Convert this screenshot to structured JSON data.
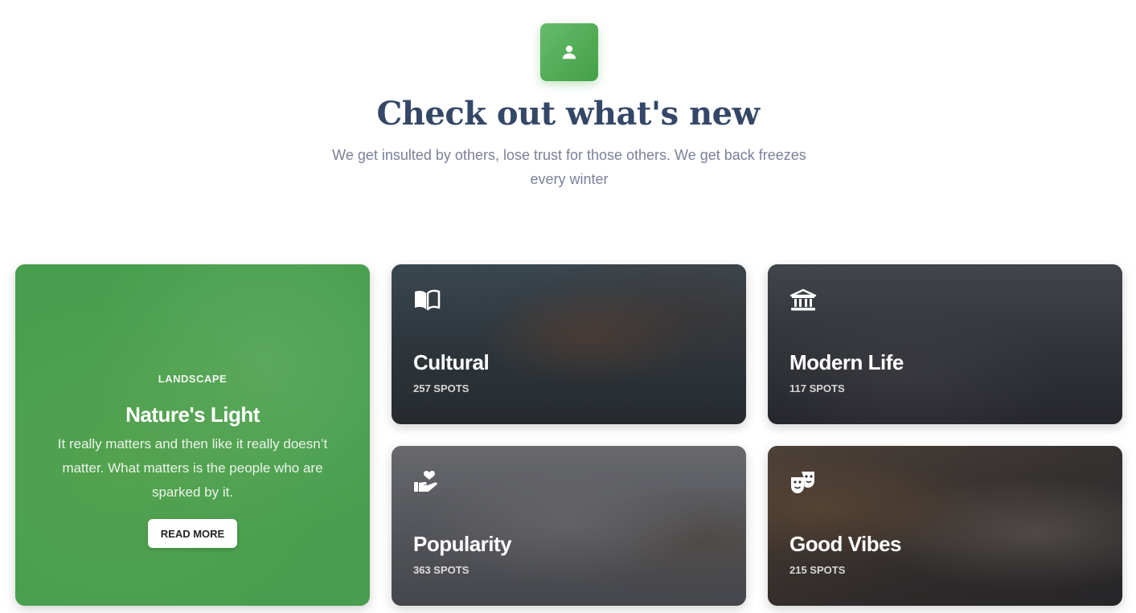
{
  "header": {
    "icon": "user-icon",
    "title": "Check out what's new",
    "subtitle": "We get insulted by others, lose trust for those others. We get back freezes every winter"
  },
  "featured": {
    "category": "LANDSCAPE",
    "title": "Nature's Light",
    "description": "It really matters and then like it really doesn’t matter. What matters is the people who are sparked by it.",
    "button_label": "READ MORE",
    "accent": "#4caf50"
  },
  "cards": [
    {
      "icon": "book-icon",
      "title": "Cultural",
      "spots": "257 SPOTS"
    },
    {
      "icon": "museum-icon",
      "title": "Modern Life",
      "spots": "117 SPOTS"
    },
    {
      "icon": "hand-heart-icon",
      "title": "Popularity",
      "spots": "363 SPOTS"
    },
    {
      "icon": "theater-masks-icon",
      "title": "Good Vibes",
      "spots": "215 SPOTS"
    }
  ]
}
